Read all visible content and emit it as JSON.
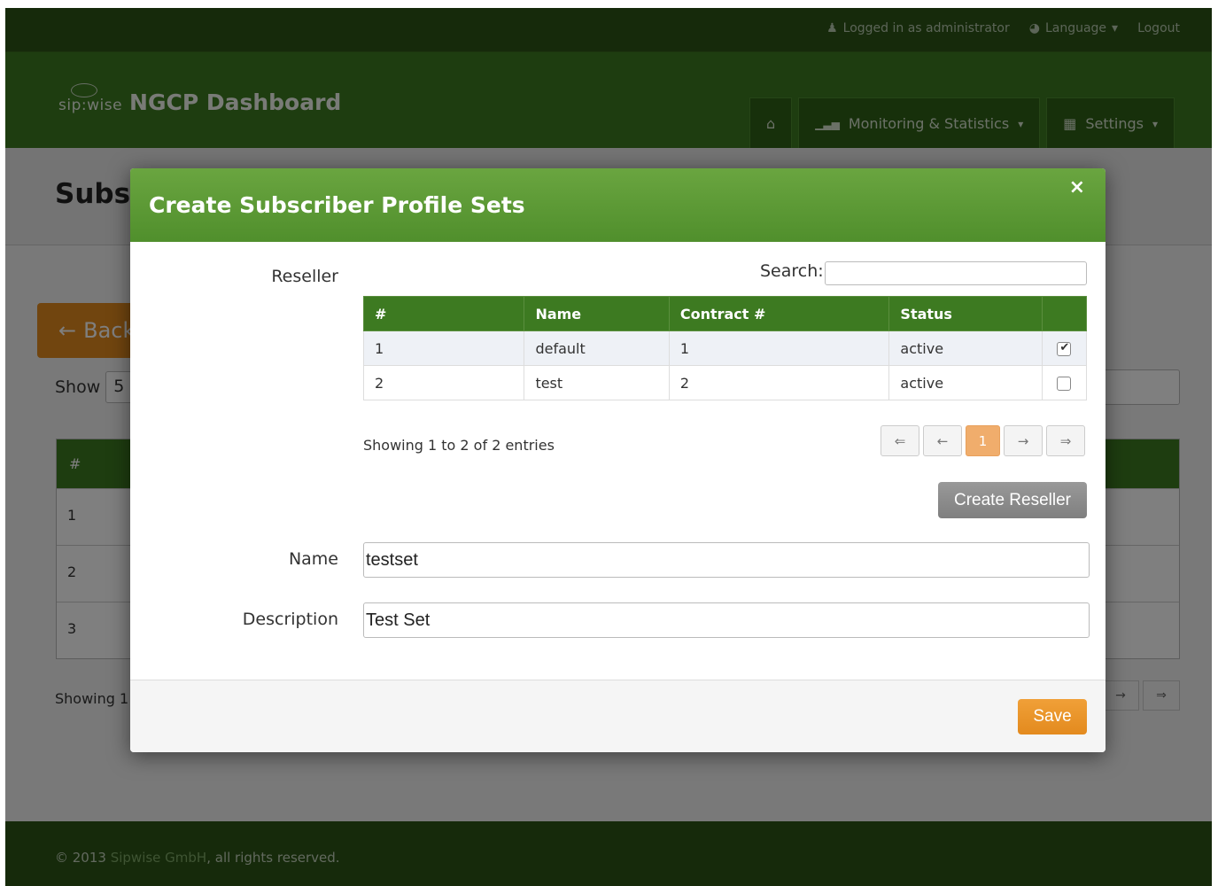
{
  "topbar": {
    "logged_in": "Logged in as administrator",
    "language": "Language",
    "logout": "Logout"
  },
  "header": {
    "brand": "sip:wise",
    "title": "NGCP Dashboard",
    "nav": [
      {
        "label": "",
        "icon": "home-icon"
      },
      {
        "label": "Monitoring & Statistics",
        "icon": "bar-chart-icon"
      },
      {
        "label": "Settings",
        "icon": "grid-icon"
      }
    ]
  },
  "background": {
    "page_title": "Subsc",
    "back_label": "Back",
    "show_label": "Show",
    "show_value": "5",
    "table_header": "#",
    "rows": [
      "1",
      "2",
      "3"
    ],
    "showing": "Showing 1"
  },
  "modal": {
    "title": "Create Subscriber Profile Sets",
    "close": "×",
    "reseller_label": "Reseller",
    "search_label": "Search:",
    "search_value": "",
    "columns": [
      "#",
      "Name",
      "Contract #",
      "Status",
      ""
    ],
    "rows": [
      {
        "id": "1",
        "name": "default",
        "contract": "1",
        "status": "active",
        "selected": true
      },
      {
        "id": "2",
        "name": "test",
        "contract": "2",
        "status": "active",
        "selected": false
      }
    ],
    "showing": "Showing 1 to 2 of 2 entries",
    "pager": [
      "⇐",
      "←",
      "1",
      "→",
      "⇒"
    ],
    "create_reseller": "Create Reseller",
    "name_label": "Name",
    "name_value": "testset",
    "description_label": "Description",
    "description_value": "Test Set",
    "save": "Save"
  },
  "footer": {
    "prefix": "© 2013 ",
    "company": "Sipwise GmbH",
    "suffix": ", all rights reserved."
  },
  "colors": {
    "green_dark": "#2c5416",
    "green": "#3d7a21",
    "orange": "#e38a1e"
  }
}
